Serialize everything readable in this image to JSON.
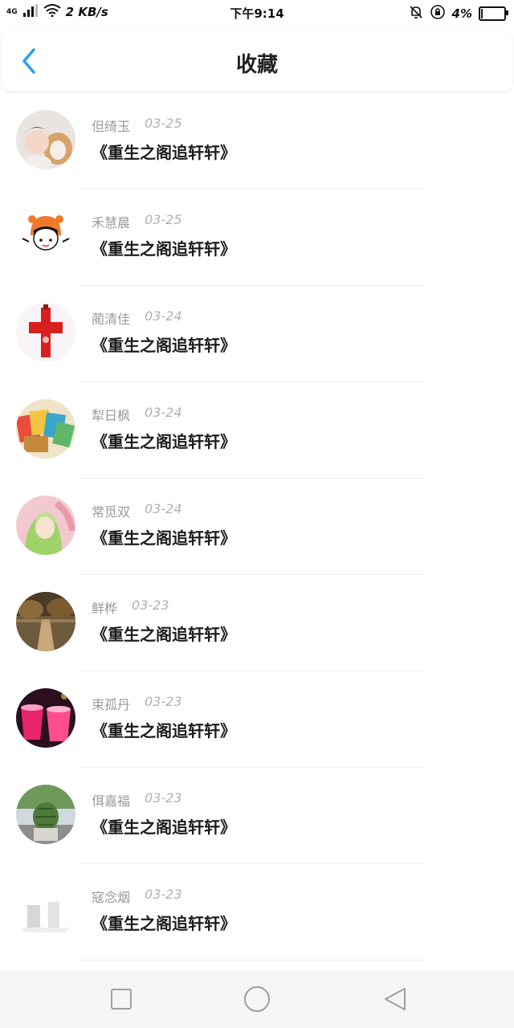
{
  "status_bar": {
    "network": "4G",
    "speed": "2 KB/s",
    "time": "下午9:14",
    "battery": "4%",
    "battery_level": 0.04
  },
  "header": {
    "title": "收藏"
  },
  "favorites": [
    {
      "name": "但绮玉",
      "date": "03-25",
      "title": "《重生之阁追轩轩》",
      "avatar_icon": "girl-with-dog-photo"
    },
    {
      "name": "禾慧晨",
      "date": "03-25",
      "title": "《重生之阁追轩轩》",
      "avatar_icon": "cartoon-girl-tiger-hat"
    },
    {
      "name": "蔺清佳",
      "date": "03-24",
      "title": "《重生之阁追轩轩》",
      "avatar_icon": "red-cross-ornament"
    },
    {
      "name": "犁日枫",
      "date": "03-24",
      "title": "《重生之阁追轩轩》",
      "avatar_icon": "colorful-notebooks-photo"
    },
    {
      "name": "常觅双",
      "date": "03-24",
      "title": "《重生之阁追轩轩》",
      "avatar_icon": "anime-illustration"
    },
    {
      "name": "鲜桦",
      "date": "03-23",
      "title": "《重生之阁追轩轩》",
      "avatar_icon": "autumn-path-photo"
    },
    {
      "name": "束孤丹",
      "date": "03-23",
      "title": "《重生之阁追轩轩》",
      "avatar_icon": "pink-drinks-photo"
    },
    {
      "name": "佴嘉福",
      "date": "03-23",
      "title": "《重生之阁追轩轩》",
      "avatar_icon": "cactus-photo"
    },
    {
      "name": "寇念烟",
      "date": "03-23",
      "title": "《重生之阁追轩轩》",
      "avatar_icon": "faded-photo"
    }
  ],
  "colors": {
    "accent": "#2a9df4",
    "text_primary": "#1c1c1c",
    "text_secondary": "#9a9a9a"
  }
}
